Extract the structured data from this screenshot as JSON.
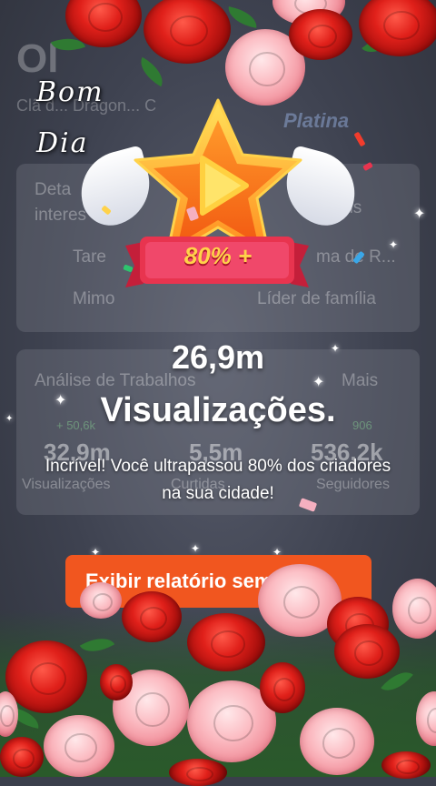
{
  "background_page": {
    "title_fragment": "Ol",
    "subtitle_fragment": "Clã d... Dragon... C",
    "tier_label": "Platina",
    "details_card": {
      "heading_line1": "Deta",
      "heading_line2": "interes",
      "right_label": "ais",
      "row1_left": "Tare",
      "row1_right": "ma de R...",
      "row2_left": "Mimo",
      "row2_right": "Líder de família"
    },
    "analysis_card": {
      "heading": "Análise de Trabalhos",
      "more_label": "Mais",
      "delta_left": "+ 50,6k",
      "delta_right": "906",
      "stats": [
        "32,9m",
        "5,5m",
        "536,2k"
      ],
      "stat_labels": [
        "Visualizações",
        "Curtidas",
        "Seguidores"
      ]
    }
  },
  "overlay": {
    "greeting_line1": "Bom",
    "greeting_line2": "Dia",
    "badge_text": "80% +",
    "views_value": "26,9m",
    "views_label": "Visualizações.",
    "message": "Incrível! Você ultrapassou 80% dos criadores na sua cidade!",
    "report_button": "Exibir relatório semanal"
  },
  "colors": {
    "accent_orange": "#f1561f",
    "badge_ribbon": "#e8344f",
    "star_gold": "#ffb020"
  }
}
